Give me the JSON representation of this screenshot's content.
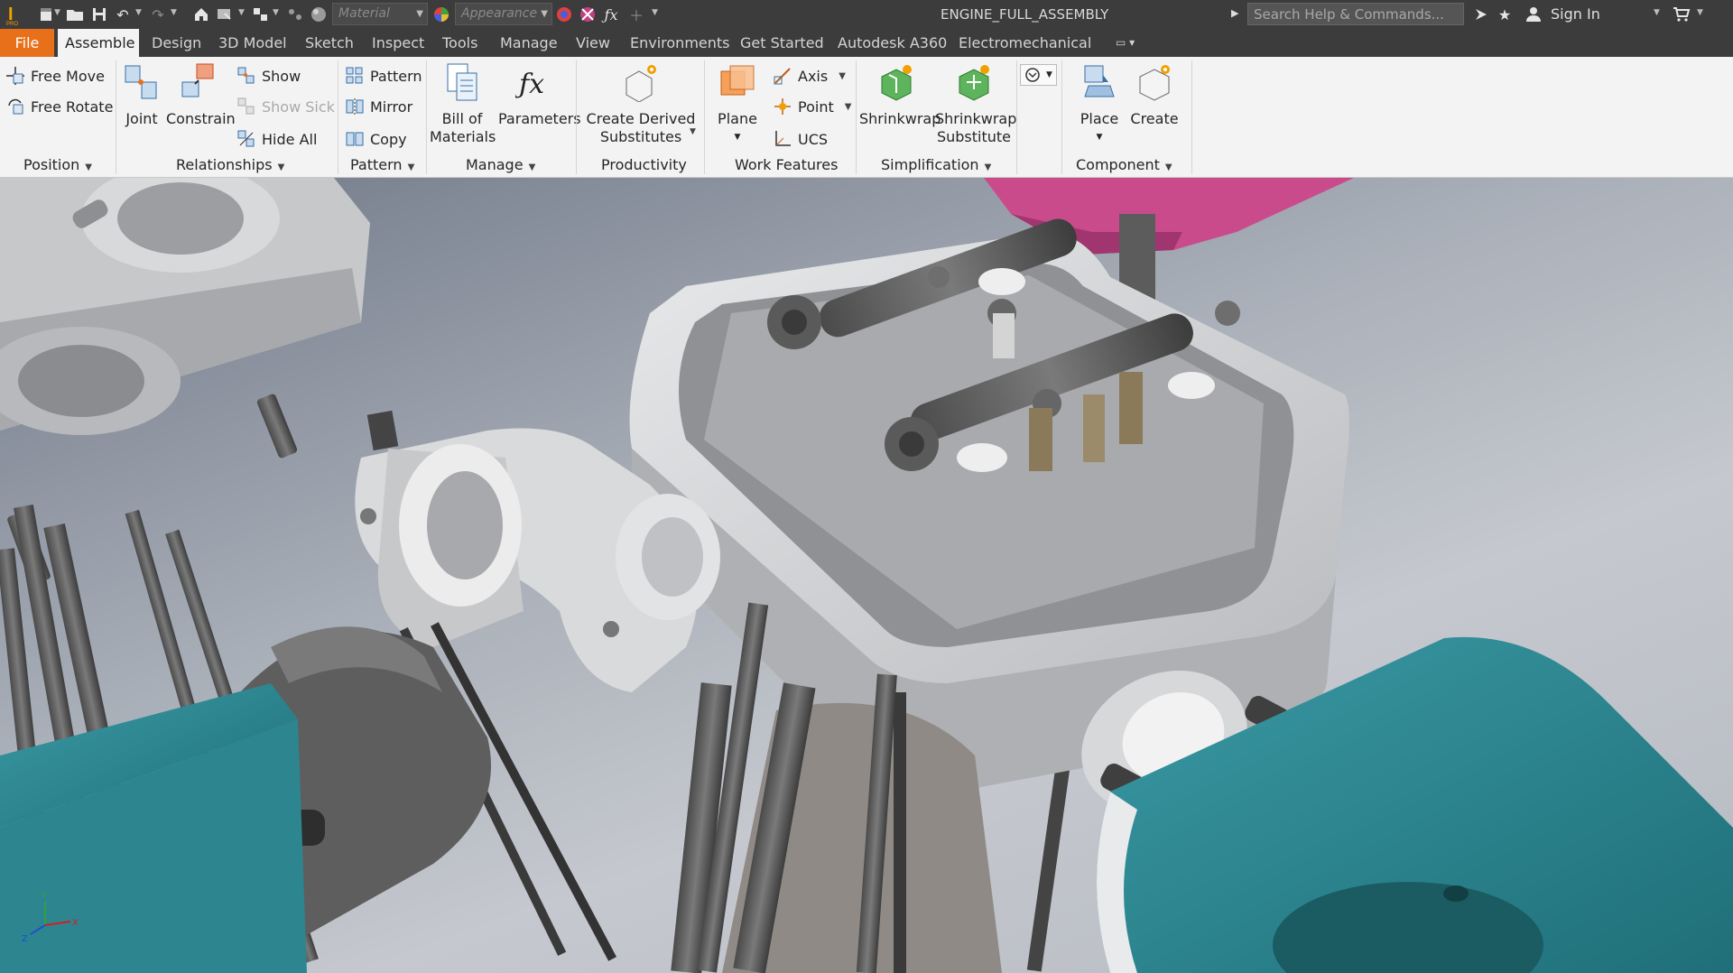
{
  "titlebar": {
    "material_placeholder": "Material",
    "appearance_placeholder": "Appearance",
    "document_title": "ENGINE_FULL_ASSEMBLY",
    "search_placeholder": "Search Help & Commands...",
    "sign_in_label": "Sign In"
  },
  "tabs": {
    "file": "File",
    "items": [
      "Assemble",
      "Design",
      "3D Model",
      "Sketch",
      "Inspect",
      "Tools",
      "Manage",
      "View",
      "Environments",
      "Get Started",
      "Autodesk A360",
      "Electromechanical"
    ]
  },
  "ribbon": {
    "position": {
      "free_move": "Free Move",
      "free_rotate": "Free Rotate",
      "label": "Position"
    },
    "relationships": {
      "joint": "Joint",
      "constrain": "Constrain",
      "show": "Show",
      "show_sick": "Show Sick",
      "hide_all": "Hide All",
      "label": "Relationships"
    },
    "pattern": {
      "pattern": "Pattern",
      "mirror": "Mirror",
      "copy": "Copy",
      "label": "Pattern"
    },
    "manage": {
      "bom_line1": "Bill of",
      "bom_line2": "Materials",
      "parameters": "Parameters",
      "label": "Manage"
    },
    "productivity": {
      "create_derived_line1": "Create Derived",
      "create_derived_line2": "Substitutes",
      "label": "Productivity"
    },
    "work_features": {
      "plane": "Plane",
      "axis": "Axis",
      "point": "Point",
      "ucs": "UCS",
      "label": "Work Features"
    },
    "simplification": {
      "shrinkwrap": "Shrinkwrap",
      "shrinkwrap_sub_line1": "Shrinkwrap",
      "shrinkwrap_sub_line2": "Substitute",
      "label": "Simplification"
    },
    "component": {
      "place": "Place",
      "create": "Create",
      "label": "Component"
    }
  },
  "colors": {
    "titlebar_bg": "#3c3c3c",
    "file_tab": "#e8701a",
    "ribbon_bg": "#f3f3f3",
    "cover_magenta": "#c94b8c",
    "teal_part": "#2f8d98",
    "head_grey": "#d6d7d9"
  }
}
